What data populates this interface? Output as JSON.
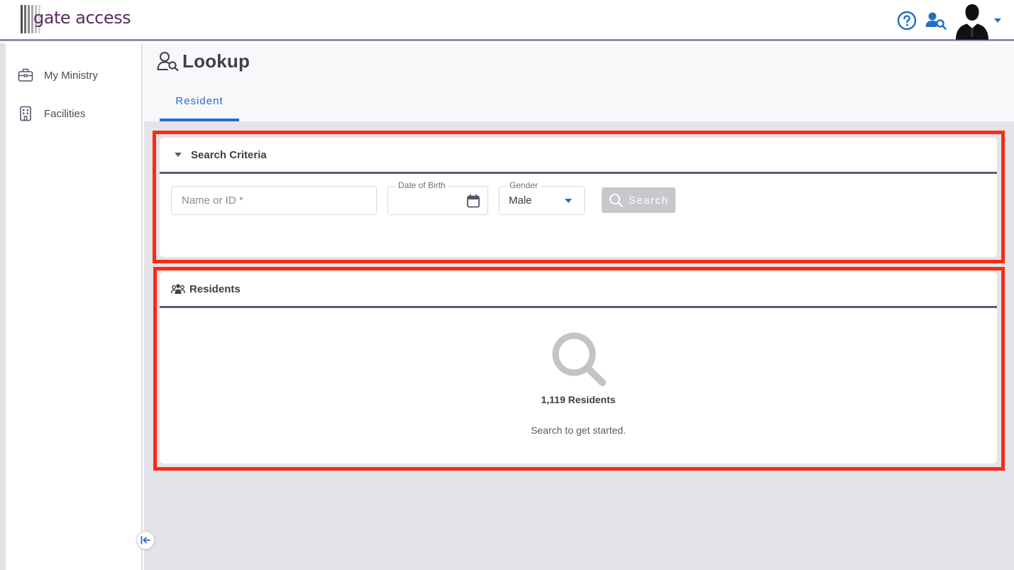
{
  "header": {
    "logo_text": "gate access",
    "logo_bar_colors": [
      "#4a4a4a",
      "#6e6e6e",
      "#8c8c8c",
      "#a8a8a8",
      "#c2c2c2",
      "#d6d6d6"
    ],
    "accent": "#1f6fc9",
    "help_icon": "question-circle-icon",
    "lookup_icon": "user-search-icon",
    "avatar_icon": "avatar-silhouette-icon"
  },
  "sidebar": {
    "items": [
      {
        "label": "My Ministry",
        "icon": "briefcase-icon"
      },
      {
        "label": "Facilities",
        "icon": "building-icon"
      }
    ],
    "collapse_icon": "collapse-left-icon"
  },
  "page": {
    "title": "Lookup",
    "tabs": [
      {
        "label": "Resident",
        "active": true
      }
    ]
  },
  "search_criteria": {
    "title": "Search Criteria",
    "name_placeholder": "Name or ID *",
    "name_value": "",
    "dob_label": "Date of Birth",
    "dob_value": "",
    "gender_label": "Gender",
    "gender_value": "Male",
    "search_label": "Search"
  },
  "residents": {
    "title": "Residents",
    "count": "1,119 Residents",
    "hint": "Search to get started."
  },
  "colors": {
    "highlight": "#fa2b12",
    "card_divider": "#5b5a7e",
    "disabled_button": "#c8c8cc"
  }
}
